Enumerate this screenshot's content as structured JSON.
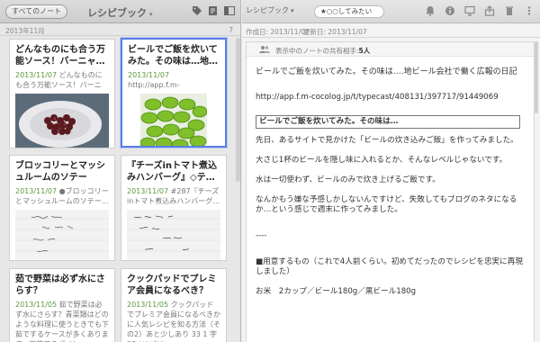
{
  "left_toolbar": {
    "all_notes_button": "すべてのノート",
    "notebook_title": "レシピブック",
    "notebook_caret": "▾"
  },
  "list_header": {
    "month": "2013年11月",
    "count": "7"
  },
  "cards": [
    {
      "title": "どんなものにも合う万能ソース！バーニャ…",
      "date": "2013/11/07",
      "snippet": "どんなものにも合う万能ソース！バーニャ…"
    },
    {
      "title": "ビールでご飯を炊いてみた。その味は…地…",
      "date": "2013/11/07",
      "snippet": "http://app.f.m-cocolog.jp/t/typecast/40…"
    },
    {
      "title": "ブロッコリーとマッシュルームのソテー",
      "date": "2013/11/07",
      "snippet": "●ブロッコリーとマッシュルームのソテー…"
    },
    {
      "title": "『チーズinトマト煮込みハンバーグ』◇テ…",
      "date": "2013/11/07",
      "snippet": "#287『チーズinトマト煮込みハンバーグ…"
    },
    {
      "title": "茹で野菜は必ず水にさらす？",
      "date": "2013/11/05",
      "snippet": "茹で野菜は必ず水にさらす？青菜類はどのような料理に使うときでも下茹でするケースが多くあります。下茹でのポイン…"
    },
    {
      "title": "クックパッドでプレミア会員になるべき？",
      "date": "2013/11/05",
      "snippet": "クックパッドでプレミア会員になるべきかに人気レシピを知る方法（その2）あと少しあり 33 1 字 28 いいね！"
    }
  ],
  "right_toolbar": {
    "notebook_select": "レシピブック",
    "tag": "★○○してみたい"
  },
  "meta": {
    "created": "作成日: 2013/11/07",
    "updated": "更新日: 2013/11/07"
  },
  "share_bar": {
    "label": "表示中のノートの共有相手:",
    "count": "5人"
  },
  "note": {
    "title": "ビールでご飯を炊いてみた。その味は….地ビール会社で働く広報の日記",
    "url": "http://app.f.m-cocolog.jp/t/typecast/408131/397717/91449069",
    "heading": "ビールでご飯を炊いてみた。その味は…",
    "p1": "先日、あるサイトで見かけた「ビールの炊き込みご飯」を作ってみました。",
    "p2": "大さじ1杯のビールを隠し味に入れるとか、そんなレベルじゃないです。",
    "p3": "水は一切使わず、ビールのみで炊き上げるご飯です。",
    "p4": "なんかもう嫌な予感しかしないんですけど、失敗してもブログのネタになるか…という感じで週末に作ってみました。",
    "sep": "----",
    "p5": "■用意するもの（これで4人前くらい。初めてだったのでレシピを忠実に再現しました）",
    "p6": "お米　2カップ／ビール180g／黒ビール180g"
  }
}
